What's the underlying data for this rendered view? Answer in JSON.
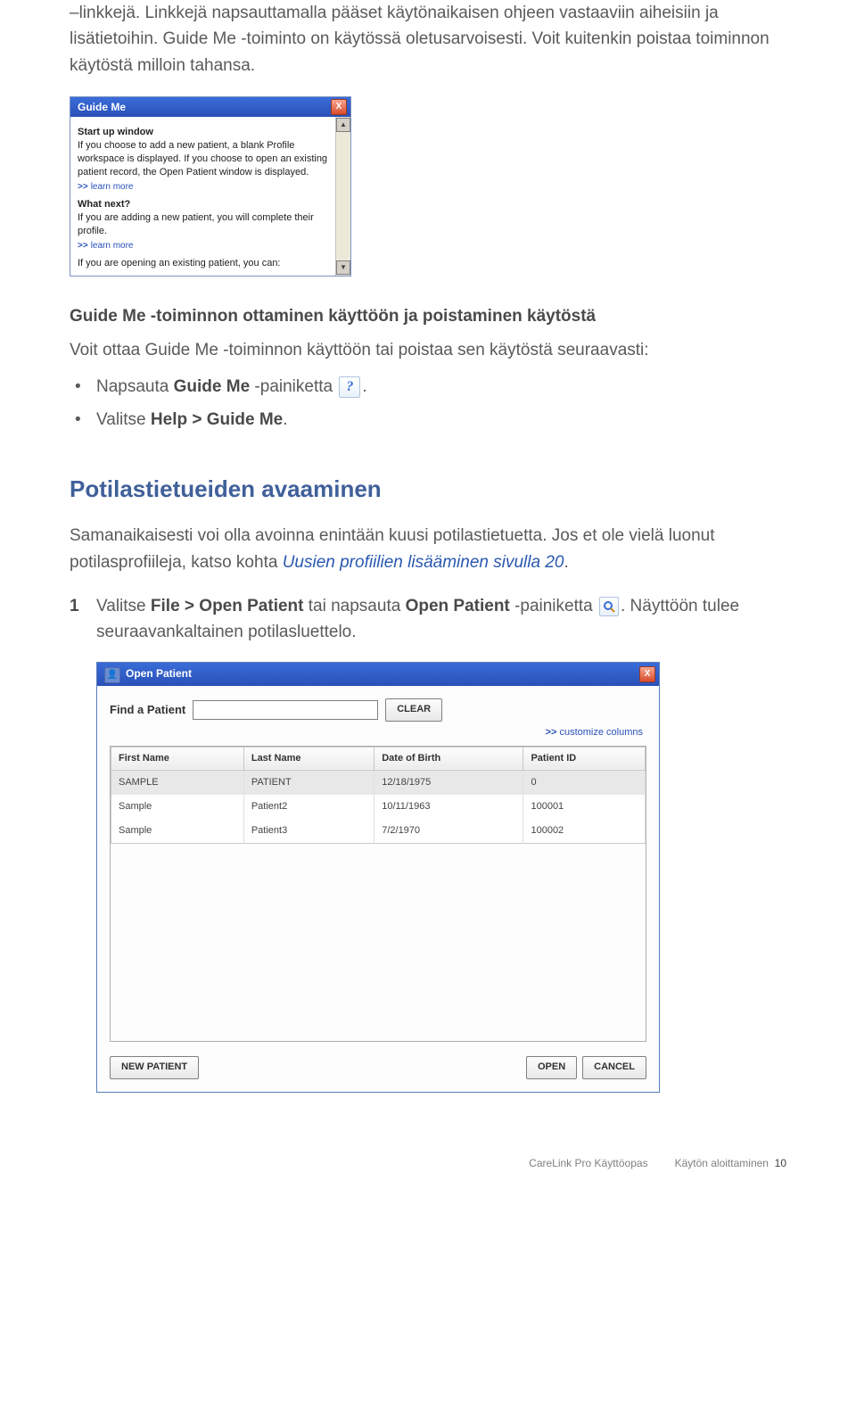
{
  "para1": "–linkkejä. Linkkejä napsauttamalla pääset käytönaikaisen ohjeen vastaaviin aiheisiin ja lisätietoihin. Guide Me -toiminto on käytössä oletusarvoisesti. Voit kuitenkin poistaa toiminnon käytöstä milloin tahansa.",
  "guide_window": {
    "title": "Guide Me",
    "close": "X",
    "h1": "Start up window",
    "p1": "If you choose to add a new patient, a blank Profile workspace is displayed. If you choose to open an existing patient record, the Open Patient window is displayed.",
    "learn": "learn more",
    "h2": "What next?",
    "p2": "If you are adding a new patient, you will complete their profile.",
    "p3": "If you are opening an existing patient, you can:"
  },
  "section1": {
    "heading": "Guide Me -toiminnon ottaminen käyttöön ja poistaminen käytöstä",
    "intro": "Voit ottaa Guide Me -toiminnon käyttöön tai poistaa sen käytöstä seuraavasti:",
    "b1a": "Napsauta ",
    "b1b": "Guide Me",
    "b1c": " -painiketta ",
    "b1d": ".",
    "b2a": "Valitse ",
    "b2b": "Help > Guide Me",
    "b2c": "."
  },
  "section2": {
    "heading": "Potilastietueiden avaaminen",
    "p1a": "Samanaikaisesti voi olla avoinna enintään kuusi potilastietuetta. Jos et ole vielä luonut potilasprofiileja, katso kohta ",
    "p1link": "Uusien profiilien lisääminen sivulla 20",
    "p1b": ".",
    "step_n": "1",
    "step_a": "Valitse ",
    "step_b": "File > Open Patient",
    "step_c": " tai napsauta ",
    "step_d": "Open Patient",
    "step_e": " -painiketta ",
    "step_f": ". Näyttöön tulee seuraavankaltainen potilasluettelo."
  },
  "open_dialog": {
    "title": "Open Patient",
    "close": "X",
    "find_label": "Find a Patient",
    "find_value": "",
    "clear": "CLEAR",
    "customize": "customize columns",
    "headers": [
      "First Name",
      "Last Name",
      "Date of Birth",
      "Patient ID"
    ],
    "rows": [
      [
        "SAMPLE",
        "PATIENT",
        "12/18/1975",
        "0"
      ],
      [
        "Sample",
        "Patient2",
        "10/11/1963",
        "100001"
      ],
      [
        "Sample",
        "Patient3",
        "7/2/1970",
        "100002"
      ]
    ],
    "new_patient": "NEW PATIENT",
    "open": "OPEN",
    "cancel": "CANCEL"
  },
  "footer": {
    "left": "CareLink Pro Käyttöopas",
    "mid": "Käytön aloittaminen",
    "page": "10"
  },
  "icons": {
    "question": "?",
    "chev": ">>"
  }
}
